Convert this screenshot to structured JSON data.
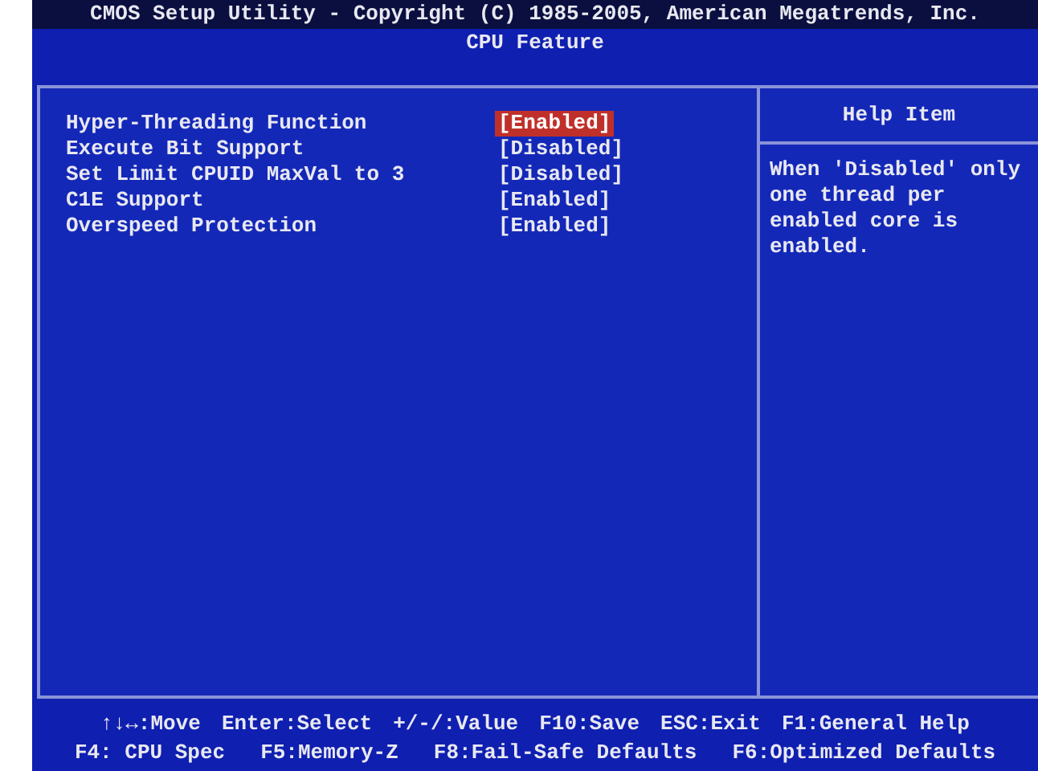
{
  "header": {
    "title": "CMOS Setup Utility - Copyright (C) 1985-2005, American Megatrends, Inc.",
    "subtitle": "CPU Feature"
  },
  "settings": [
    {
      "label": "Hyper-Threading Function",
      "value": "[Enabled]",
      "selected": true
    },
    {
      "label": "Execute Bit Support",
      "value": "[Disabled]",
      "selected": false
    },
    {
      "label": "Set Limit CPUID MaxVal to 3",
      "value": "[Disabled]",
      "selected": false
    },
    {
      "label": "C1E Support",
      "value": "[Enabled]",
      "selected": false
    },
    {
      "label": "Overspeed Protection",
      "value": "[Enabled]",
      "selected": false
    }
  ],
  "help": {
    "title": "Help Item",
    "text": "When 'Disabled' only one thread per enabled core is enabled."
  },
  "footer": [
    [
      "↑↓↔:Move",
      "Enter:Select",
      "+/-/:Value",
      "F10:Save",
      "ESC:Exit",
      "F1:General Help"
    ],
    [
      "F4: CPU Spec",
      "F5:Memory-Z",
      "F8:Fail-Safe Defaults",
      "F6:Optimized Defaults"
    ]
  ]
}
